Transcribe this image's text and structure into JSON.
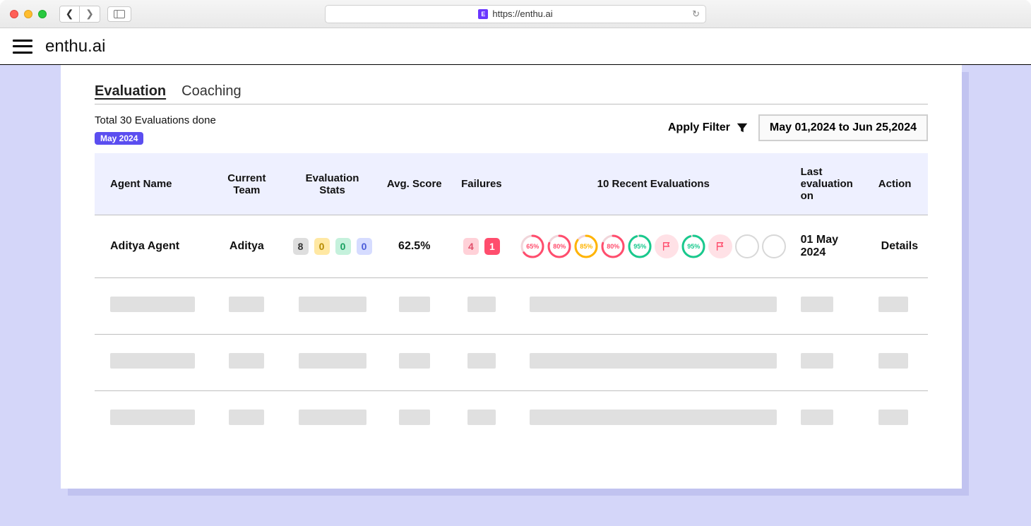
{
  "browser": {
    "url": "https://enthu.ai",
    "favicon_letter": "E"
  },
  "header": {
    "brand": "enthu.ai"
  },
  "tabs": {
    "evaluation": "Evaluation",
    "coaching": "Coaching"
  },
  "summary": {
    "text": "Total 30 Evaluations done",
    "month_badge": "May 2024"
  },
  "filter": {
    "apply_label": "Apply Filter",
    "date_range": "May 01,2024 to Jun 25,2024"
  },
  "columns": {
    "agent_name": "Agent Name",
    "current_team": "Current Team",
    "eval_stats": "Evaluation Stats",
    "avg_score": "Avg. Score",
    "failures": "Failures",
    "recent": "10 Recent Evaluations",
    "last_eval": "Last evaluation on",
    "action": "Action"
  },
  "row1": {
    "agent_name": "Aditya Agent",
    "team": "Aditya",
    "stats": {
      "gray": "8",
      "yellow": "0",
      "green": "0",
      "blue": "0"
    },
    "avg_score": "62.5%",
    "failures": {
      "light": "4",
      "solid": "1"
    },
    "recent": [
      {
        "type": "ring",
        "pct": 65,
        "color": "#ff4d6d",
        "label": "65%"
      },
      {
        "type": "ring",
        "pct": 80,
        "color": "#ff4d6d",
        "label": "80%"
      },
      {
        "type": "ring",
        "pct": 85,
        "color": "#ffb400",
        "label": "85%"
      },
      {
        "type": "ring",
        "pct": 80,
        "color": "#ff4d6d",
        "label": "80%"
      },
      {
        "type": "ring",
        "pct": 95,
        "color": "#18c98d",
        "label": "95%"
      },
      {
        "type": "flag"
      },
      {
        "type": "ring",
        "pct": 95,
        "color": "#18c98d",
        "label": "95%"
      },
      {
        "type": "flag"
      },
      {
        "type": "empty"
      },
      {
        "type": "empty"
      }
    ],
    "last_eval": "01 May 2024",
    "action": "Details"
  }
}
